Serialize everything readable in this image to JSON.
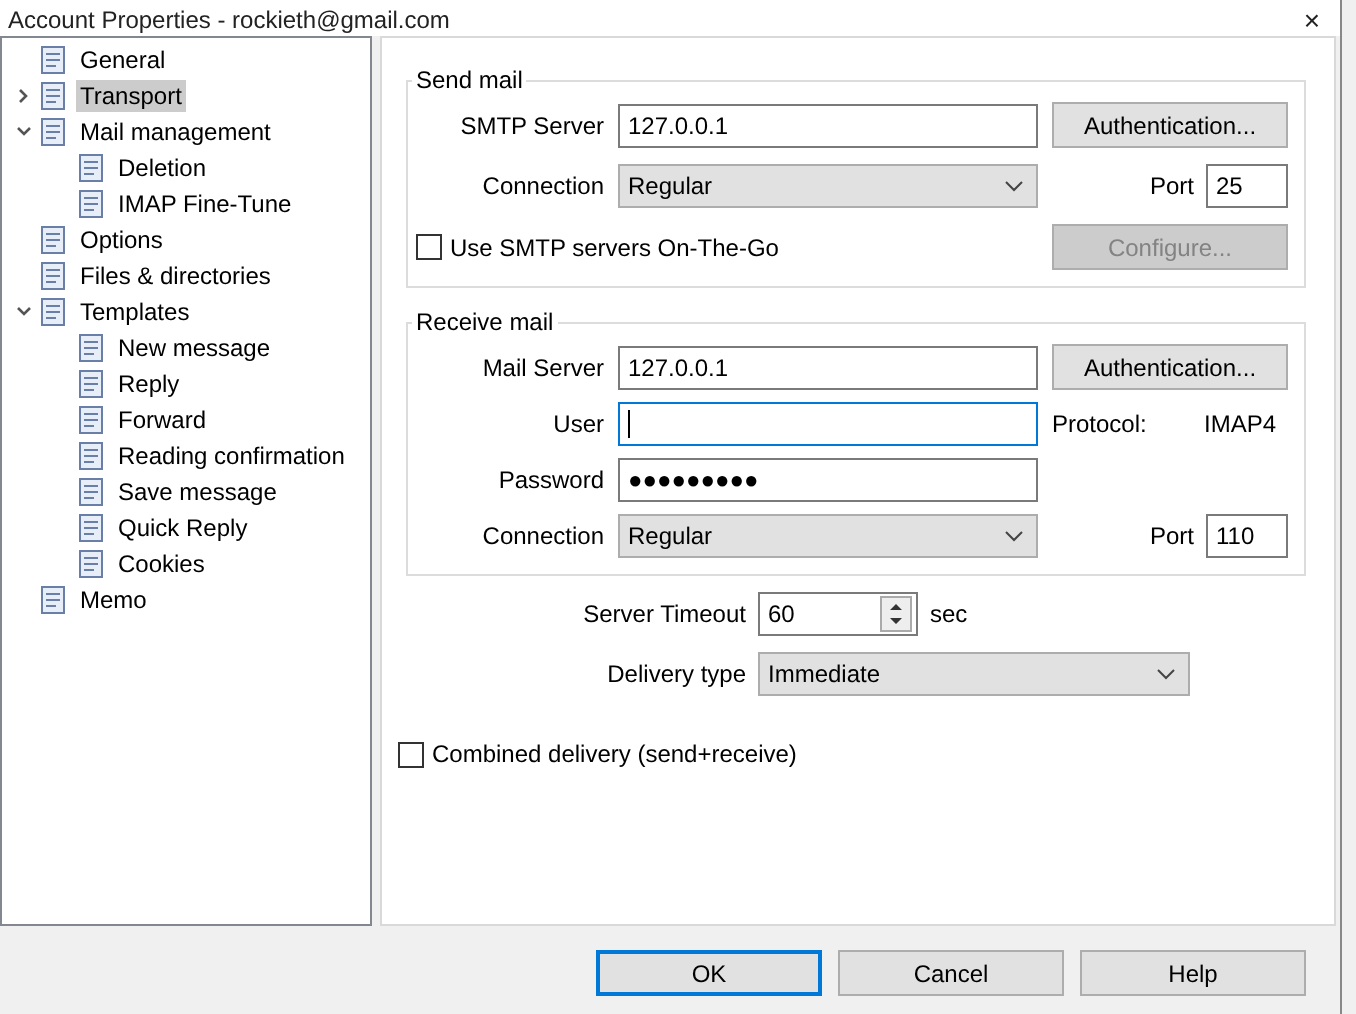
{
  "window": {
    "title": "Account Properties - rockieth@gmail.com",
    "close": "×"
  },
  "tree": [
    {
      "label": "General",
      "selected": false
    },
    {
      "label": "Transport",
      "selected": true,
      "expanded": false
    },
    {
      "label": "Mail management",
      "selected": false,
      "expanded": true,
      "children": [
        {
          "label": "Deletion",
          "selected": false
        },
        {
          "label": "IMAP Fine-Tune",
          "selected": false
        }
      ]
    },
    {
      "label": "Options",
      "selected": false
    },
    {
      "label": "Files & directories",
      "selected": false
    },
    {
      "label": "Templates",
      "selected": false,
      "expanded": true,
      "children": [
        {
          "label": "New message",
          "selected": false
        },
        {
          "label": "Reply",
          "selected": false
        },
        {
          "label": "Forward",
          "selected": false
        },
        {
          "label": "Reading confirmation",
          "selected": false
        },
        {
          "label": "Save message",
          "selected": false
        },
        {
          "label": "Quick Reply",
          "selected": false
        },
        {
          "label": "Cookies",
          "selected": false
        }
      ]
    },
    {
      "label": "Memo",
      "selected": false
    }
  ],
  "send_mail": {
    "title": "Send mail",
    "server_label": "SMTP Server",
    "server": "127.0.0.1",
    "auth_button": "Authentication...",
    "connection_label": "Connection",
    "connection": "Regular",
    "port_label": "Port",
    "port": "25",
    "on_the_go": {
      "label": "Use SMTP servers On-The-Go",
      "checked": false
    },
    "configure_button": {
      "label": "Configure...",
      "disabled": true
    }
  },
  "receive_mail": {
    "title": "Receive mail",
    "server_label": "Mail Server",
    "server": "127.0.0.1",
    "auth_button": "Authentication...",
    "user_label": "User",
    "protocol_label": "Protocol:",
    "protocol": "IMAP4",
    "password_label": "Password",
    "password": "●●●●●●●●●",
    "connection_label": "Connection",
    "connection": "Regular",
    "port_label": "Port",
    "port": "110"
  },
  "timeout": {
    "label": "Server Timeout",
    "value": "60",
    "unit": "sec"
  },
  "delivery": {
    "label": "Delivery type",
    "value": "Immediate"
  },
  "combined": {
    "label": "Combined delivery (send+receive)",
    "checked": false
  },
  "buttons": [
    {
      "label": "OK",
      "default": true
    },
    {
      "label": "Cancel",
      "default": false
    },
    {
      "label": "Help",
      "default": false
    }
  ]
}
